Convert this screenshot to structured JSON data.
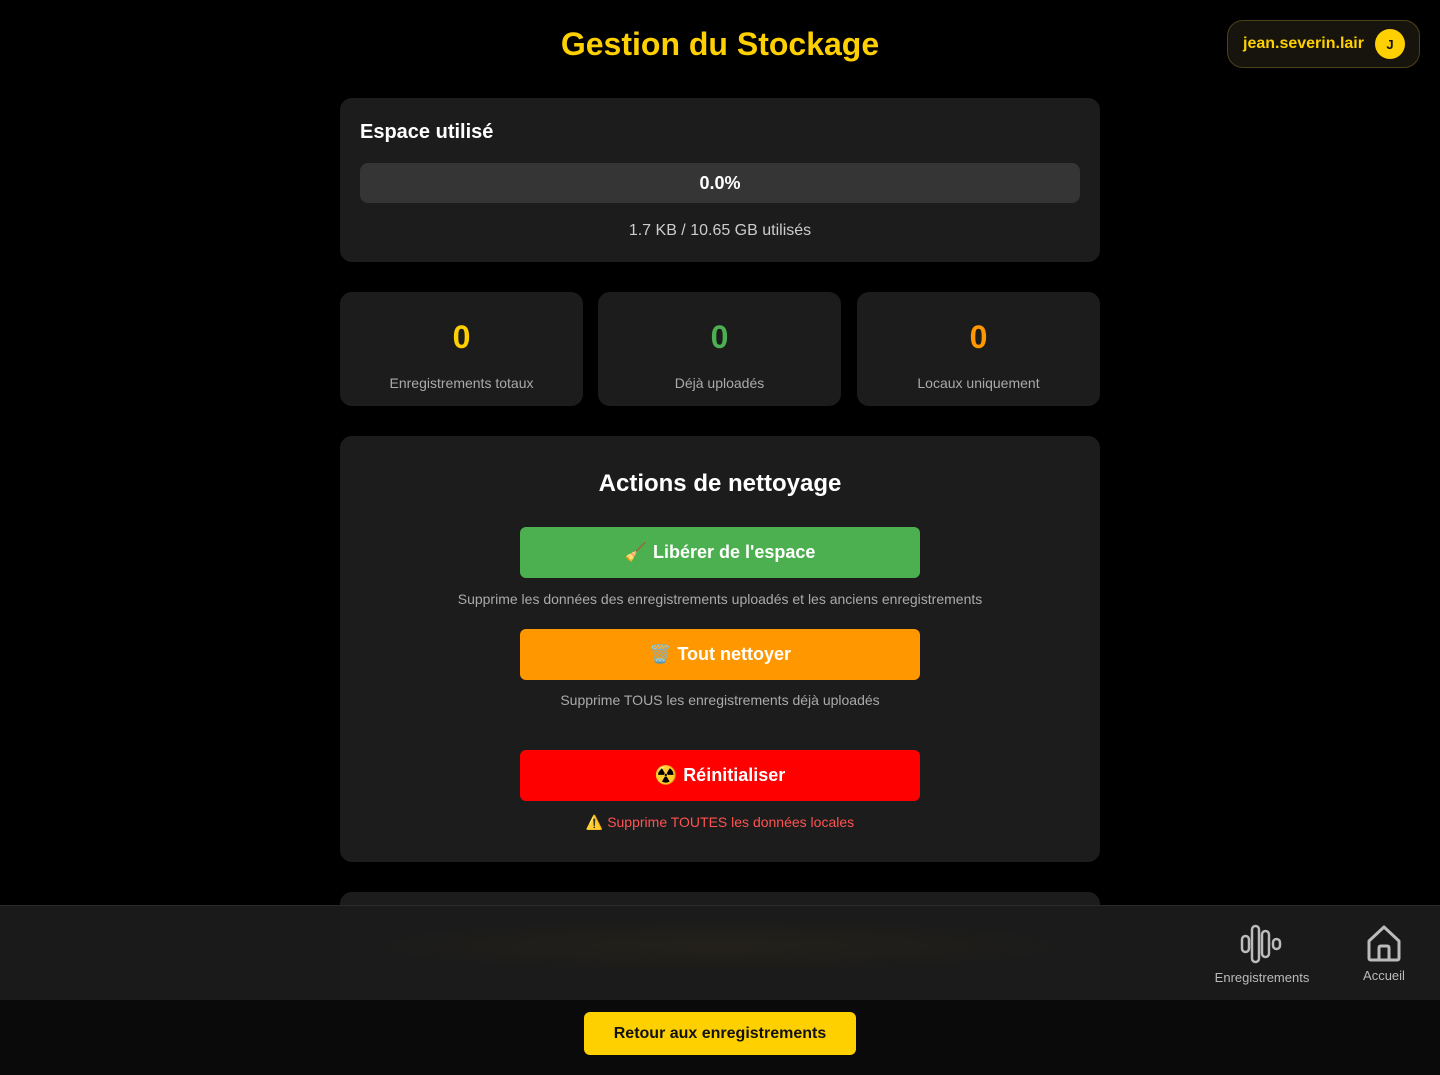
{
  "header": {
    "title": "Gestion du Stockage",
    "user_name": "jean.severin.lair",
    "user_initial": "J"
  },
  "usage": {
    "title": "Espace utilisé",
    "percent": 0.0,
    "percent_label": "0.0%",
    "detail": "1.7 KB / 10.65 GB utilisés"
  },
  "stats": [
    {
      "value": "0",
      "label": "Enregistrements totaux",
      "color": "#ffd000"
    },
    {
      "value": "0",
      "label": "Déjà uploadés",
      "color": "#4caf50"
    },
    {
      "value": "0",
      "label": "Locaux uniquement",
      "color": "#ff9800"
    }
  ],
  "actions": {
    "title": "Actions de nettoyage",
    "items": [
      {
        "emoji": "🧹",
        "label": "Libérer de l'espace",
        "description": "Supprime les données des enregistrements uploadés et les anciens enregistrements",
        "color": "#4caf50"
      },
      {
        "emoji": "🗑️",
        "label": "Tout nettoyer",
        "description": "Supprime TOUS les enregistrements déjà uploadés",
        "color": "#ff9800"
      },
      {
        "emoji": "☢️",
        "label": "Réinitialiser",
        "warning_icon": "⚠️",
        "description": "Supprime TOUTES les données locales",
        "color": "#ff0000",
        "description_color": "#ff5252"
      }
    ]
  },
  "bottom_nav": {
    "recordings_label": "Enregistrements",
    "home_label": "Accueil",
    "recordings_icon": "waveform-icon",
    "home_icon": "home-icon"
  },
  "footer": {
    "back_label": "Retour aux enregistrements"
  }
}
